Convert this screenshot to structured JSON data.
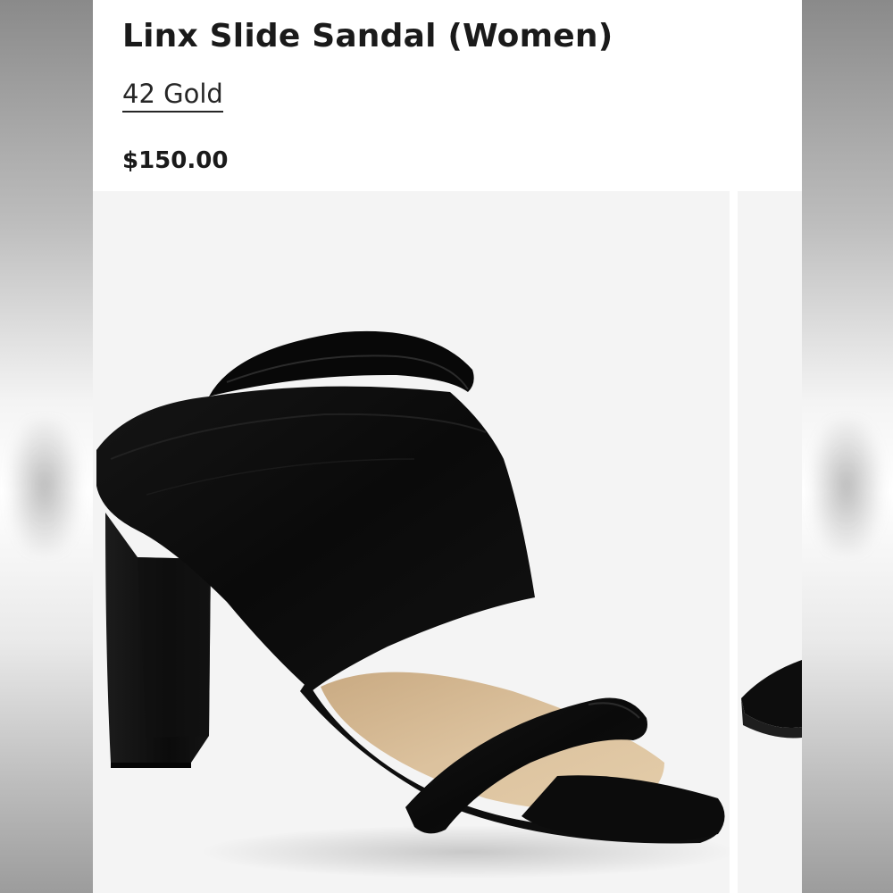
{
  "product": {
    "title": "Linx Slide Sandal (Women)",
    "variant": "42 Gold",
    "price": "$150.00"
  },
  "colors": {
    "page_background": "#ffffff",
    "image_background": "#f4f4f4",
    "text_primary": "#1a1a1a",
    "shoe_suede": "#0d0d0d",
    "footbed": "#d8bd98"
  },
  "gallery": {
    "images": [
      {
        "alt": "black suede slide sandal with block heel",
        "state": "current"
      },
      {
        "alt": "next product image",
        "state": "partially visible"
      }
    ]
  }
}
